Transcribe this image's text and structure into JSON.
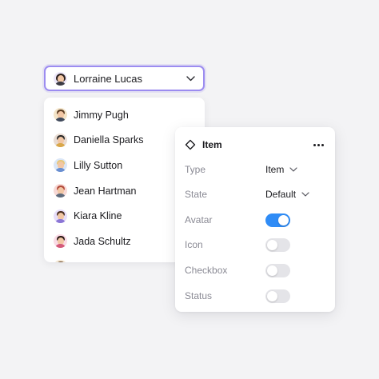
{
  "select": {
    "selected": "Lorraine Lucas",
    "avatar": "avatar-lorraine"
  },
  "dropdown": {
    "items": [
      {
        "label": "Jimmy Pugh",
        "avatar_bg": "#f3e4c8",
        "hair": "#5a3b22",
        "shirt": "#3f4a5c"
      },
      {
        "label": "Daniella Sparks",
        "avatar_bg": "#e9dcd3",
        "hair": "#2a2a2a",
        "shirt": "#d9a74a"
      },
      {
        "label": "Lilly Sutton",
        "avatar_bg": "#dbe7f7",
        "hair": "#e7c77a",
        "shirt": "#6a8fd1"
      },
      {
        "label": "Jean Hartman",
        "avatar_bg": "#f7d9d6",
        "hair": "#b34a3a",
        "shirt": "#5e6b7d"
      },
      {
        "label": "Kiara Kline",
        "avatar_bg": "#e7defa",
        "hair": "#4a2f22",
        "shirt": "#8b76d6"
      },
      {
        "label": "Jada Schultz",
        "avatar_bg": "#fadbe6",
        "hair": "#2b1b18",
        "shirt": "#d45a7a"
      },
      {
        "label": "",
        "avatar_bg": "#f3e7d4",
        "hair": "#6b4a2a",
        "shirt": "#9aa3ad"
      }
    ]
  },
  "panel": {
    "title": "Item",
    "rows": [
      {
        "label": "Type",
        "kind": "select",
        "value": "Item"
      },
      {
        "label": "State",
        "kind": "select",
        "value": "Default"
      },
      {
        "label": "Avatar",
        "kind": "toggle",
        "on": true
      },
      {
        "label": "Icon",
        "kind": "toggle",
        "on": false
      },
      {
        "label": "Checkbox",
        "kind": "toggle",
        "on": false
      },
      {
        "label": "Status",
        "kind": "toggle",
        "on": false
      }
    ]
  },
  "colors": {
    "accent_border": "#9c8cf0",
    "toggle_on": "#2f8cf6",
    "toggle_off": "#e4e4e8",
    "label_muted": "#8a8a94"
  }
}
